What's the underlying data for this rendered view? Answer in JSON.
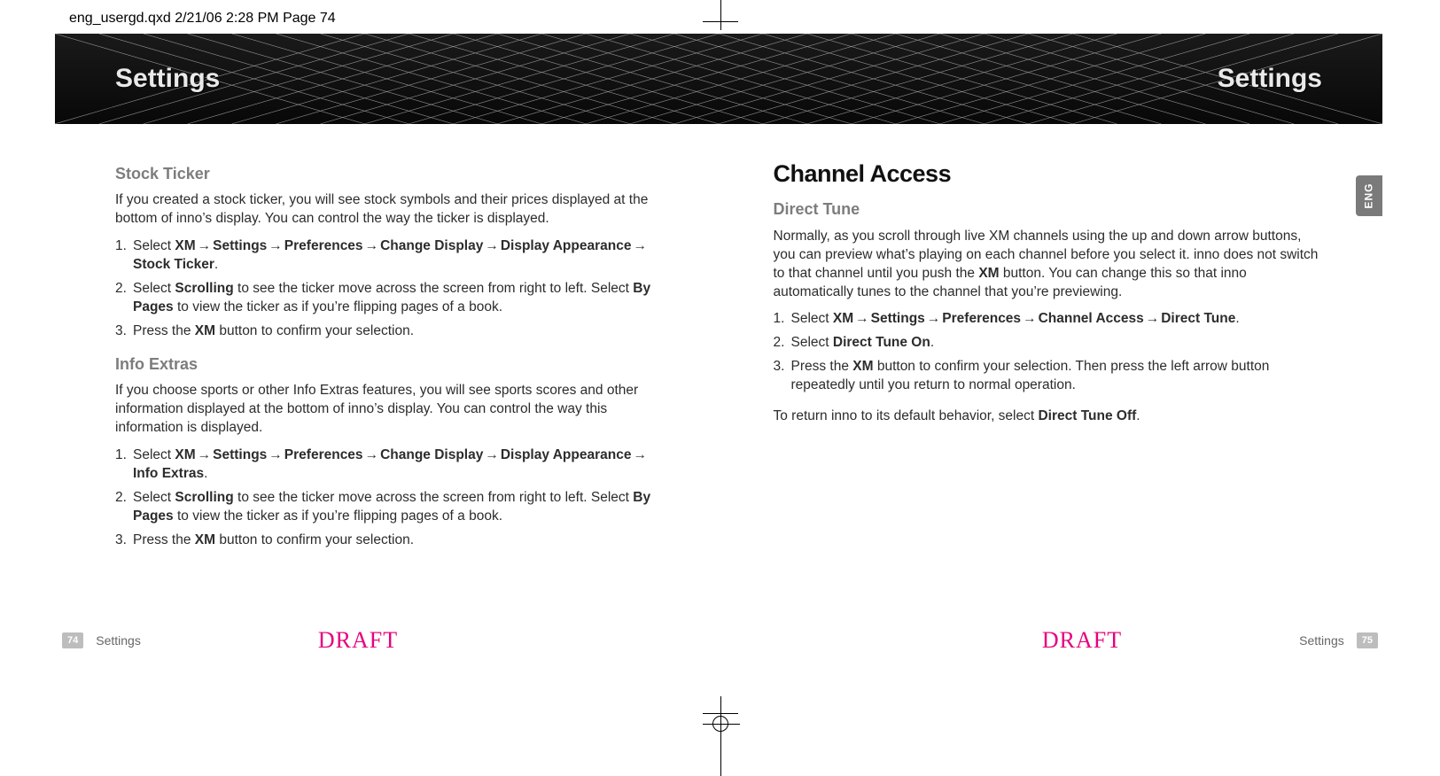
{
  "meta": {
    "slug": "eng_usergd.qxd  2/21/06  2:28 PM  Page 74"
  },
  "banner": {
    "left": "Settings",
    "right": "Settings"
  },
  "tab": {
    "label": "ENG"
  },
  "arrow_glyph": "→",
  "left_page": {
    "sections": [
      {
        "heading3": "Stock Ticker",
        "intro": "If you created a stock ticker, you will see stock symbols and their prices displayed at the bottom of inno’s display. You can control the way the ticker is displayed.",
        "steps": [
          {
            "num": "1.",
            "pre": "Select ",
            "path": [
              "XM",
              "Settings",
              "Preferences",
              "Change Display",
              "Display Appearance",
              "Stock Ticker"
            ],
            "post": "."
          },
          {
            "num": "2.",
            "text_parts": [
              "Select ",
              {
                "b": "Scrolling"
              },
              " to see the ticker move across the screen from right to left. Select ",
              {
                "b": "By Pages"
              },
              " to view the ticker as if you’re flipping pages of a book."
            ]
          },
          {
            "num": "3.",
            "text_parts": [
              "Press the ",
              {
                "b": "XM"
              },
              " button to confirm your selection."
            ]
          }
        ]
      },
      {
        "heading3": "Info Extras",
        "intro": "If you choose sports or other Info Extras features, you will see sports scores and other information displayed at the bottom of inno’s display. You can control the way this information is displayed.",
        "steps": [
          {
            "num": "1.",
            "pre": "Select ",
            "path": [
              "XM",
              "Settings",
              "Preferences",
              "Change Display",
              "Display Appearance",
              "Info Extras"
            ],
            "post": "."
          },
          {
            "num": "2.",
            "text_parts": [
              "Select ",
              {
                "b": "Scrolling"
              },
              " to see the ticker move across the screen from right to left. Select ",
              {
                "b": "By Pages"
              },
              " to view the ticker as if you’re flipping pages of a book."
            ]
          },
          {
            "num": "3.",
            "text_parts": [
              "Press the ",
              {
                "b": "XM"
              },
              " button to confirm your selection."
            ]
          }
        ]
      }
    ]
  },
  "right_page": {
    "heading2": "Channel Access",
    "sections": [
      {
        "heading3": "Direct Tune",
        "intro_parts": [
          "Normally, as you scroll through live XM channels using the up and down arrow buttons, you can preview what’s playing on each channel before you select it. inno does not switch to that channel until you push the ",
          {
            "b": "XM"
          },
          " button. You can change this so that inno automatically tunes to the channel that you’re previewing."
        ],
        "steps": [
          {
            "num": "1.",
            "pre": "Select ",
            "path": [
              "XM",
              "Settings",
              "Preferences",
              "Channel Access",
              "Direct Tune"
            ],
            "post": "."
          },
          {
            "num": "2.",
            "text_parts": [
              "Select ",
              {
                "b": "Direct Tune On"
              },
              "."
            ]
          },
          {
            "num": "3.",
            "text_parts": [
              "Press the ",
              {
                "b": "XM"
              },
              " button to confirm your selection. Then press the left arrow button repeatedly until you return to normal operation."
            ]
          }
        ],
        "outro_parts": [
          "To return inno to its default behavior, select ",
          {
            "b": "Direct Tune Off"
          },
          "."
        ]
      }
    ]
  },
  "footer": {
    "left_num": "74",
    "left_label": "Settings",
    "right_label": "Settings",
    "right_num": "75",
    "draft": "DRAFT"
  }
}
